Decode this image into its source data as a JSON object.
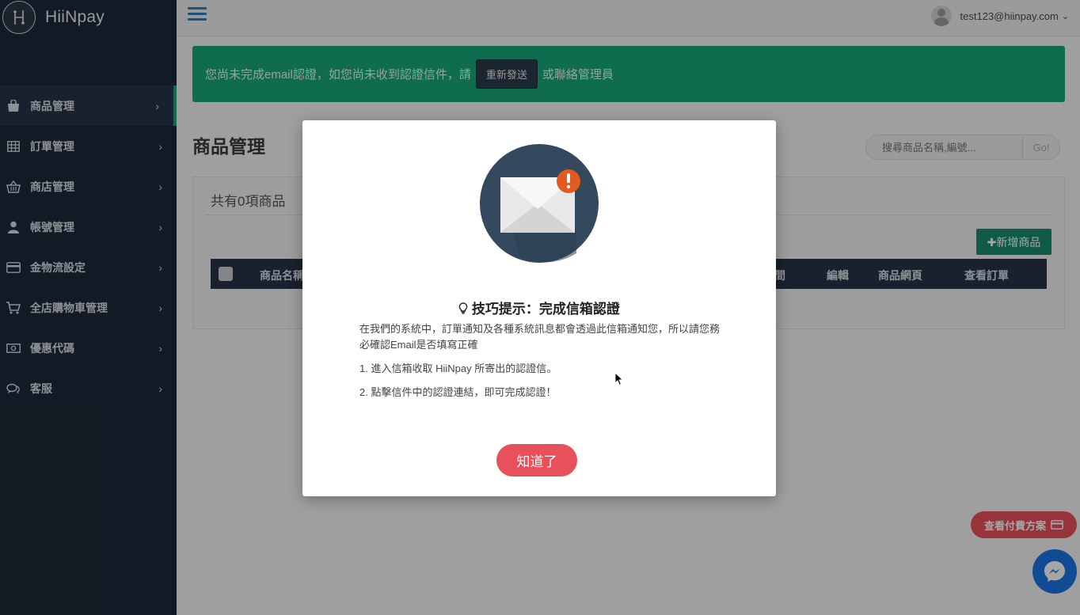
{
  "brand": {
    "name": "HiiNpay"
  },
  "sidebar": {
    "items": [
      {
        "label": "商品管理",
        "icon": "shopping-bag-icon",
        "active": true
      },
      {
        "label": "訂單管理",
        "icon": "table-icon",
        "active": false
      },
      {
        "label": "商店管理",
        "icon": "basket-icon",
        "active": false
      },
      {
        "label": "帳號管理",
        "icon": "user-icon",
        "active": false
      },
      {
        "label": "金物流設定",
        "icon": "credit-card-icon",
        "active": false
      },
      {
        "label": "全店購物車管理",
        "icon": "cart-icon",
        "active": false
      },
      {
        "label": "優惠代碼",
        "icon": "money-icon",
        "active": false
      },
      {
        "label": "客服",
        "icon": "chat-icon",
        "active": false
      }
    ]
  },
  "topbar": {
    "user_email": "test123@hiinpay.com"
  },
  "alert": {
    "text_before": "您尚未完成email認證，如您尚未收到認證信件，請",
    "button": "重新發送",
    "text_after": "或聯絡管理員"
  },
  "main": {
    "title": "商品管理",
    "search_placeholder": "搜尋商品名稱,編號...",
    "search_button": "Go!",
    "count_text": "共有0項商品",
    "add_button": "✚新增商品",
    "columns": [
      "商品名稱",
      "間",
      "編輯",
      "商品網頁",
      "查看訂單"
    ]
  },
  "modal": {
    "title": "技巧提示：完成信箱認證",
    "intro": "在我們的系統中，訂單通知及各種系統訊息都會透過此信箱通知您，所以請您務必確認Email是否填寫正確",
    "step1": "1. 進入信箱收取 HiiNpay 所寄出的認證信。",
    "step2": "2. 點擊信件中的認證連結，即可完成認證！",
    "ok_button": "知道了"
  },
  "floating": {
    "pay_plan_button": "查看付費方案"
  },
  "colors": {
    "sidebar_bg": "#1d2939",
    "alert_green": "#1aa67a",
    "accent_red": "#e8505b",
    "messenger_blue": "#1b74e4"
  }
}
